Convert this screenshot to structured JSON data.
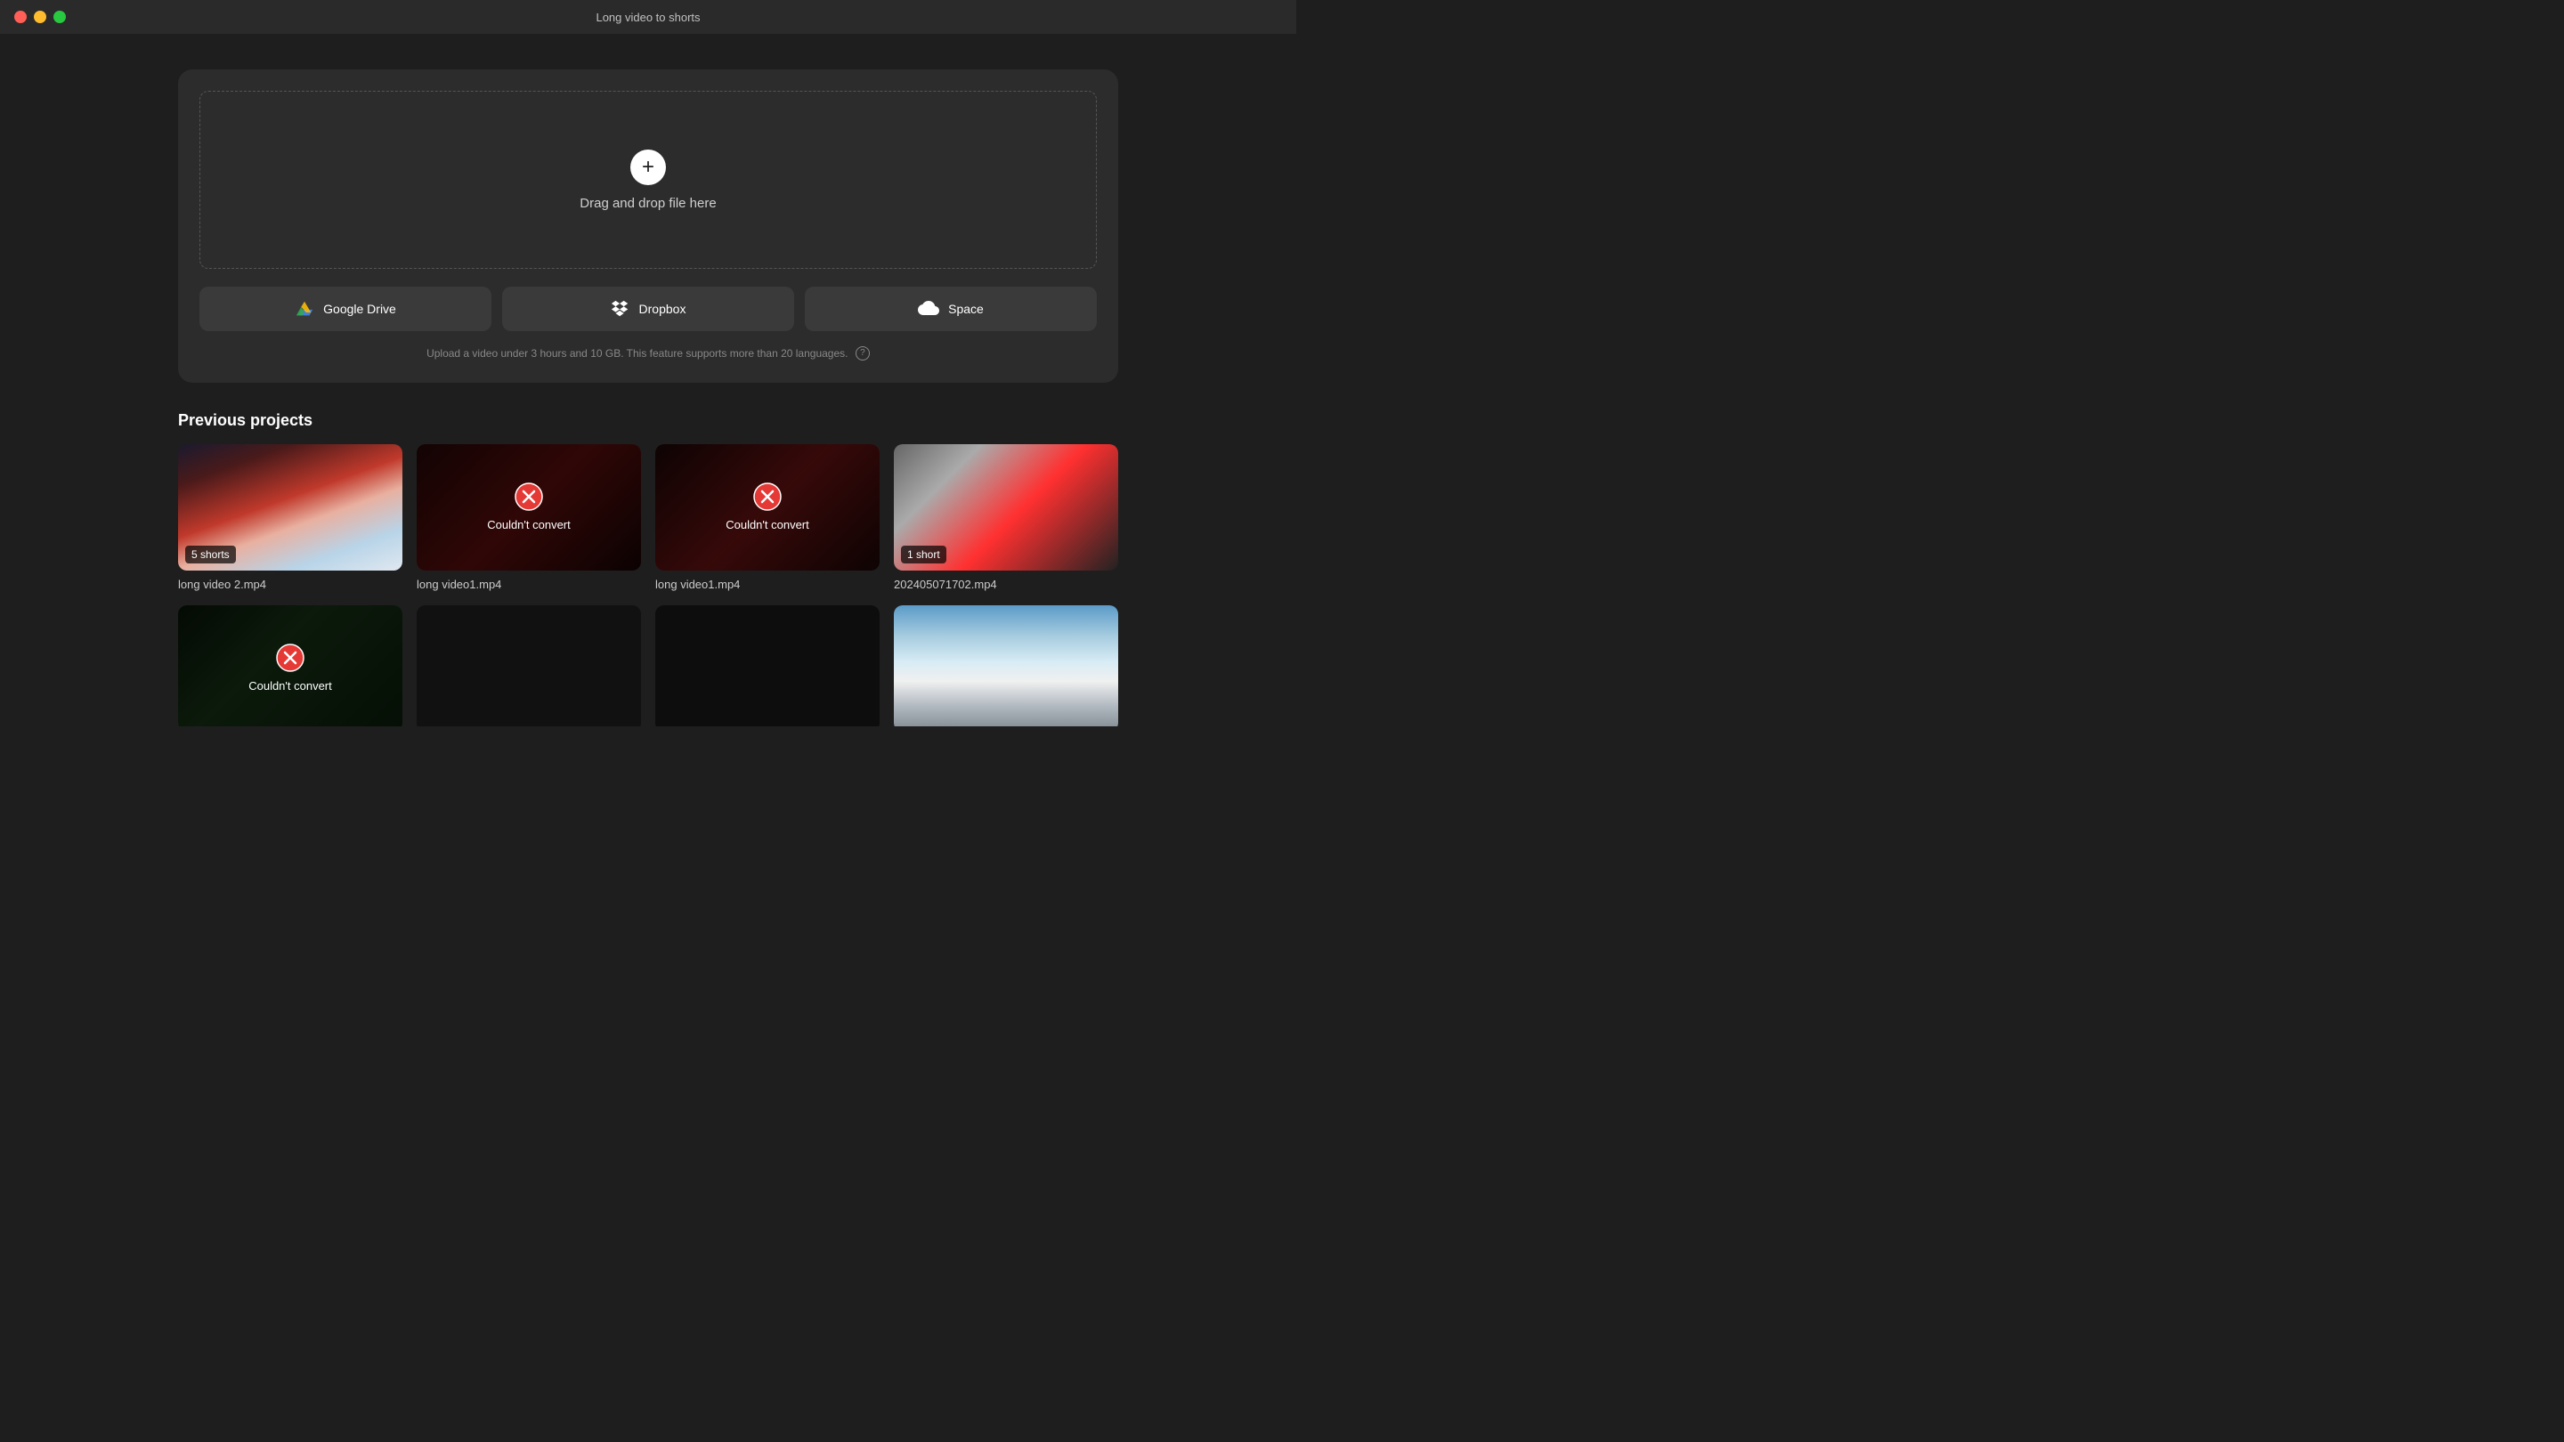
{
  "window": {
    "title": "Long video to shorts"
  },
  "traffic_lights": {
    "close": "close",
    "minimize": "minimize",
    "maximize": "maximize"
  },
  "upload": {
    "drop_text": "Drag and drop file here",
    "plus_symbol": "+",
    "note": "Upload a video under 3 hours and 10 GB. This feature supports more than 20 languages.",
    "help_symbol": "?",
    "google_drive_label": "Google Drive",
    "dropbox_label": "Dropbox",
    "space_label": "Space"
  },
  "previous_projects": {
    "title": "Previous projects",
    "items": [
      {
        "id": 1,
        "name": "long video 2.mp4",
        "badge": "5 shorts",
        "status": "ok",
        "thumb_class": "thumb-mountains"
      },
      {
        "id": 2,
        "name": "long video1.mp4",
        "badge": null,
        "status": "error",
        "error_text": "Couldn't convert",
        "thumb_class": "thumb-dark-red"
      },
      {
        "id": 3,
        "name": "long video1.mp4",
        "badge": null,
        "status": "error",
        "error_text": "Couldn't convert",
        "thumb_class": "thumb-dark-red2"
      },
      {
        "id": 4,
        "name": "202405071702.mp4",
        "badge": "1 short",
        "status": "ok",
        "thumb_class": "thumb-red-jacket"
      },
      {
        "id": 5,
        "name": "",
        "badge": null,
        "status": "error",
        "error_text": "Couldn't convert",
        "thumb_class": "thumb-dark-green"
      },
      {
        "id": 6,
        "name": "",
        "badge": null,
        "status": "partial",
        "error_text": "",
        "thumb_class": "thumb-black"
      },
      {
        "id": 7,
        "name": "",
        "badge": null,
        "status": "partial",
        "error_text": "",
        "thumb_class": "thumb-black2"
      },
      {
        "id": 8,
        "name": "",
        "badge": null,
        "status": "ok",
        "thumb_class": "thumb-sky"
      }
    ]
  }
}
